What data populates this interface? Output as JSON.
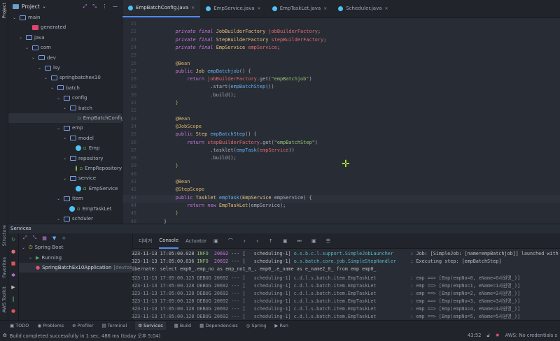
{
  "left_strip": {
    "project": "Project",
    "structure": "Structure",
    "favorites": "Favorites",
    "aws": "AWS Toolkit"
  },
  "project": {
    "title": "Project",
    "tree": [
      {
        "label": "main",
        "depth": 0,
        "icon": "folder",
        "open": true
      },
      {
        "label": "generated",
        "depth": 2,
        "icon": "folder-generated"
      },
      {
        "label": "java",
        "depth": 1,
        "icon": "folder",
        "open": true
      },
      {
        "label": "com",
        "depth": 2,
        "icon": "folder",
        "open": true
      },
      {
        "label": "dev",
        "depth": 3,
        "icon": "folder",
        "open": true
      },
      {
        "label": "lsy",
        "depth": 4,
        "icon": "folder",
        "open": true
      },
      {
        "label": "springbatchex10",
        "depth": 5,
        "icon": "folder",
        "open": true
      },
      {
        "label": "batch",
        "depth": 6,
        "icon": "folder",
        "open": true
      },
      {
        "label": "config",
        "depth": 7,
        "icon": "folder",
        "open": true
      },
      {
        "label": "batch",
        "depth": 8,
        "icon": "folder",
        "open": true
      },
      {
        "label": "EmpBatchConfig",
        "depth": 10,
        "icon": "class",
        "selected": true
      },
      {
        "label": "emp",
        "depth": 7,
        "icon": "folder",
        "open": true
      },
      {
        "label": "model",
        "depth": 8,
        "icon": "folder",
        "open": true
      },
      {
        "label": "Emp",
        "depth": 10,
        "icon": "class"
      },
      {
        "label": "repository",
        "depth": 8,
        "icon": "folder",
        "open": true
      },
      {
        "label": "EmpRepository",
        "depth": 10,
        "icon": "interface"
      },
      {
        "label": "service",
        "depth": 8,
        "icon": "folder",
        "open": true
      },
      {
        "label": "EmpService",
        "depth": 10,
        "icon": "class"
      },
      {
        "label": "item",
        "depth": 7,
        "icon": "folder",
        "open": true
      },
      {
        "label": "EmpTaskLet",
        "depth": 9,
        "icon": "class"
      },
      {
        "label": "schduler",
        "depth": 7,
        "icon": "folder",
        "open": true
      }
    ]
  },
  "tabs": [
    {
      "label": "EmpBatchConfig.java",
      "active": true
    },
    {
      "label": "EmpService.java"
    },
    {
      "label": "EmpTaskLet.java"
    },
    {
      "label": "Scheduler.java"
    }
  ],
  "editor": {
    "first_line": 21,
    "current_line": 43,
    "lines": [
      [],
      [
        [
          "    private final ",
          "ki"
        ],
        [
          "JobBuilderFactory ",
          "t"
        ],
        [
          "jobBuilderFactory",
          "f"
        ],
        [
          ";",
          "p"
        ]
      ],
      [
        [
          "    private final ",
          "ki"
        ],
        [
          "StepBuilderFactory ",
          "t"
        ],
        [
          "stepBuilderFactory",
          "f"
        ],
        [
          ";",
          "p"
        ]
      ],
      [
        [
          "    private final ",
          "ki"
        ],
        [
          "EmpService ",
          "t"
        ],
        [
          "empService",
          "f"
        ],
        [
          ";",
          "p"
        ]
      ],
      [],
      [
        [
          "    @Bean",
          "a"
        ]
      ],
      [
        [
          "    public ",
          "k"
        ],
        [
          "Job ",
          "t"
        ],
        [
          "empBatchjob",
          "m"
        ],
        [
          "() {",
          "p"
        ]
      ],
      [
        [
          "        return ",
          "k"
        ],
        [
          "jobBuilderFactory",
          "f"
        ],
        [
          ".get(",
          "p"
        ],
        [
          "\"empBatchjob\"",
          "s"
        ],
        [
          ")",
          "p"
        ]
      ],
      [
        [
          "                .start(",
          "p"
        ],
        [
          "empBatchStep",
          "m"
        ],
        [
          "())",
          "p"
        ]
      ],
      [
        [
          "                .build();",
          "p"
        ]
      ],
      [
        [
          "    }",
          "g"
        ]
      ],
      [],
      [
        [
          "    @Bean",
          "a"
        ]
      ],
      [
        [
          "    @JobScope",
          "a"
        ]
      ],
      [
        [
          "    public ",
          "k"
        ],
        [
          "Step ",
          "t"
        ],
        [
          "empBatchStep",
          "m"
        ],
        [
          "() {",
          "p"
        ]
      ],
      [
        [
          "        return ",
          "k"
        ],
        [
          "stepBuilderFactory",
          "f"
        ],
        [
          ".get(",
          "p"
        ],
        [
          "\"empBatchStep\"",
          "s"
        ],
        [
          ")",
          "p"
        ]
      ],
      [
        [
          "                .tasklet(",
          "p"
        ],
        [
          "empTask",
          "m"
        ],
        [
          "(",
          "p"
        ],
        [
          "empService",
          "f"
        ],
        [
          "))",
          "p"
        ]
      ],
      [
        [
          "                .build();",
          "p"
        ]
      ],
      [
        [
          "    }",
          "g"
        ]
      ],
      [],
      [
        [
          "    @Bean",
          "a"
        ]
      ],
      [
        [
          "    @StepScope",
          "a"
        ]
      ],
      [
        [
          "    public ",
          "k"
        ],
        [
          "Tasklet ",
          "t"
        ],
        [
          "empTask",
          "m"
        ],
        [
          "(",
          "p"
        ],
        [
          "EmpService ",
          "t"
        ],
        [
          "empService",
          "p"
        ],
        [
          ") {",
          "p"
        ]
      ],
      [
        [
          "        return new ",
          "k"
        ],
        [
          "EmpTaskLet",
          "t"
        ],
        [
          "(empService);",
          "p"
        ]
      ],
      [
        [
          "    }",
          "g"
        ]
      ],
      [
        [
          "}",
          "p"
        ]
      ]
    ]
  },
  "services": {
    "title": "Services",
    "tree": [
      {
        "label": "Spring Boot",
        "depth": 0
      },
      {
        "label": "Running",
        "depth": 1
      },
      {
        "label": "SpringBatchEx10Application",
        "suffix": "[devtools]",
        "depth": 2
      }
    ],
    "console_tabs": {
      "debugger": "디버거",
      "console": "Console",
      "actuator": "Actuator"
    },
    "log": [
      {
        "ts": "323-11-13 17:05:00.028",
        "lvl": "INFO ",
        "pid": "20692",
        "th": " --- [   scheduling-1] ",
        "logger": "o.s.b.c.l.support.SimpleJobLauncher     ",
        "msg": " : Job: [SimpleJob: [name=empBatchjob]] launched with"
      },
      {
        "ts": "323-11-13 17:05:00.036",
        "lvl": "INFO ",
        "pid": "20692",
        "th": " --- [   scheduling-1] ",
        "logger": "o.s.batch.core.job.SimpleStepHandler    ",
        "msg": " : Executing step: [empBatchStep]"
      },
      {
        "raw": "ibernate: select emp0_.emp_no as emp_no1_0_, emp0_.e_name as e_name2_0_ from emp emp0_"
      },
      {
        "dbg": "323-11-13 17:05:00.125 DEBUG 20692 --- [   scheduling-1] c.d.l.s.batch.item.EmpTaskLet            : emp ==> [Emp(empNo=0, eName=0사원명_)]"
      },
      {
        "dbg": "323-11-13 17:05:00.128 DEBUG 20692 --- [   scheduling-1] c.d.l.s.batch.item.EmpTaskLet            : emp ==> [Emp(empNo=1, eName=1사원명_)]"
      },
      {
        "dbg": "323-11-13 17:05:00.128 DEBUG 20692 --- [   scheduling-1] c.d.l.s.batch.item.EmpTaskLet            : emp ==> [Emp(empNo=2, eName=2사원명_)]"
      },
      {
        "dbg": "323-11-13 17:05:00.128 DEBUG 20692 --- [   scheduling-1] c.d.l.s.batch.item.EmpTaskLet            : emp ==> [Emp(empNo=3, eName=3사원명_)]"
      },
      {
        "dbg": "323-11-13 17:05:00.128 DEBUG 20692 --- [   scheduling-1] c.d.l.s.batch.item.EmpTaskLet            : emp ==> [Emp(empNo=4, eName=4사원명_)]"
      },
      {
        "dbg": "323-11-13 17:05:00.128 DEBUG 20692 --- [   scheduling-1] c.d.l.s.batch.item.EmpTaskLet            : emp ==> [Emp(empNo=5, eName=5사원명_)]"
      }
    ]
  },
  "bottom_tabs": [
    {
      "label": "TODO"
    },
    {
      "label": "Problems"
    },
    {
      "label": "Profiler"
    },
    {
      "label": "Terminal"
    },
    {
      "label": "Services",
      "active": true
    },
    {
      "label": "Build"
    },
    {
      "label": "Dependencies"
    },
    {
      "label": "Spring"
    },
    {
      "label": "Run"
    }
  ],
  "status": {
    "message": "Build completed successfully in 1 sec, 486 ms (today 오후 5:04)",
    "position": "43:52",
    "aws": "AWS: No credentials s"
  }
}
